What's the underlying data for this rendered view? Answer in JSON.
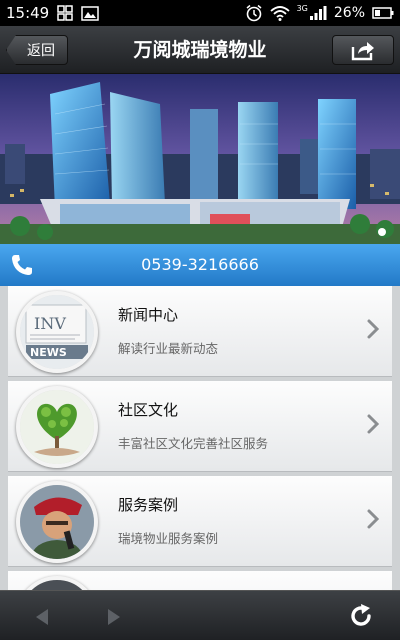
{
  "status": {
    "time": "15:49",
    "network": "3G",
    "battery": "26%"
  },
  "header": {
    "back_label": "返回",
    "title": "万阅城瑞境物业"
  },
  "contact": {
    "phone": "0539-3216666"
  },
  "list": [
    {
      "title": "新闻中心",
      "subtitle": "解读行业最新动态",
      "thumb": "news-thumbnail"
    },
    {
      "title": "社区文化",
      "subtitle": "丰富社区文化完善社区服务",
      "thumb": "heart-tree-thumbnail"
    },
    {
      "title": "服务案例",
      "subtitle": "瑞境物业服务案例",
      "thumb": "guard-thumbnail"
    }
  ],
  "colors": {
    "accent": "#2f8fde",
    "titlebar": "#2a2c2f"
  }
}
